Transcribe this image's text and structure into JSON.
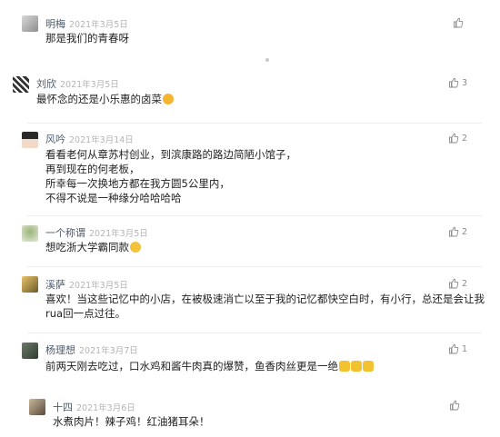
{
  "comments": [
    {
      "name": "明梅",
      "date": "2021年3月5日",
      "lines": [
        "那是我们的青春呀"
      ],
      "likes": ""
    },
    {
      "name": "刘欣",
      "date": "2021年3月5日",
      "lines": [
        "最怀念的还是小乐惠的卤菜"
      ],
      "likes": "3"
    },
    {
      "name": "风吟",
      "date": "2021年3月14日",
      "lines": [
        "看看老何从章苏村创业，到滨康路的路边简陋小馆子，",
        "再到现在的何老板，",
        "所幸每一次换地方都在我方圆5公里内，",
        "不得不说是一种缘分哈哈哈哈"
      ],
      "likes": "2"
    },
    {
      "name": "一个称谓",
      "date": "2021年3月5日",
      "lines": [
        "想吃浙大学霸同款"
      ],
      "likes": "2"
    },
    {
      "name": "溪萨",
      "date": "2021年3月5日",
      "lines": [
        "喜欢！当这些记忆中的小店，在被极速消亡以至于我的记忆都快空白时，有小行，总还是会让我",
        "rua回一点过往。"
      ],
      "likes": "2"
    },
    {
      "name": "杨理想",
      "date": "2021年3月7日",
      "lines": [
        "前两天刚去吃过，口水鸡和酱牛肉真的爆赞，鱼香肉丝更是一绝"
      ],
      "likes": "1"
    },
    {
      "name": "十四",
      "date": "2021年3月6日",
      "lines": [
        "水煮肉片！辣子鸡！红油猪耳朵！"
      ],
      "likes": ""
    }
  ],
  "icons": {
    "like": "thumbs-up-icon",
    "emoji_love": "heart-eyes-emoji",
    "emoji_grin": "grinning-emoji",
    "emoji_thumb": "thumbs-up-emoji"
  },
  "colors": {
    "name": "#4d5a6a",
    "date": "#b4b4b4",
    "like": "#8a8a8a"
  }
}
